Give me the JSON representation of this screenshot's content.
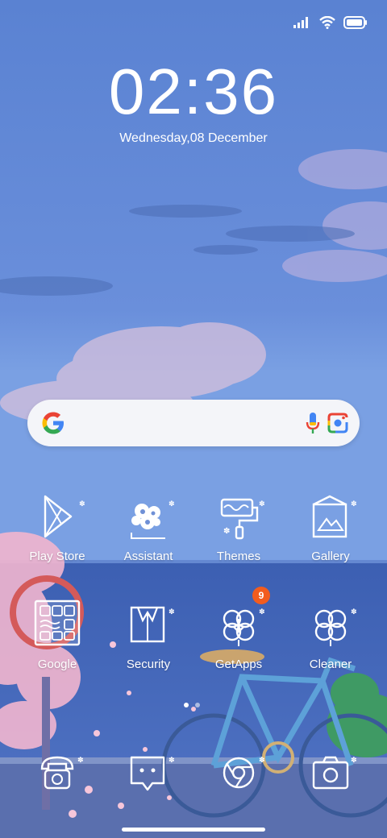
{
  "status": {
    "signal": "signal-icon",
    "wifi": "wifi-icon",
    "battery": "battery-icon"
  },
  "clock": {
    "time": "02:36",
    "date": "Wednesday,08 December"
  },
  "search": {
    "logo": "google-g-icon",
    "mic": "mic-icon",
    "lens": "google-lens-icon"
  },
  "apps": [
    {
      "label": "Play Store",
      "icon": "play-store-icon"
    },
    {
      "label": "Assistant",
      "icon": "assistant-icon"
    },
    {
      "label": "Themes",
      "icon": "themes-icon"
    },
    {
      "label": "Gallery",
      "icon": "gallery-icon"
    },
    {
      "label": "Google",
      "icon": "google-folder-icon"
    },
    {
      "label": "Security",
      "icon": "security-icon"
    },
    {
      "label": "GetApps",
      "icon": "getapps-icon",
      "badge": "9"
    },
    {
      "label": "Cleaner",
      "icon": "cleaner-icon"
    }
  ],
  "dock": [
    {
      "icon": "phone-icon"
    },
    {
      "icon": "messages-icon"
    },
    {
      "icon": "chrome-icon"
    },
    {
      "icon": "camera-icon"
    }
  ],
  "colors": {
    "sky": "#5f85d4",
    "badge": "#f25c1e",
    "sea": "#3f64b3"
  },
  "pages": {
    "count": 2,
    "active": 1
  }
}
